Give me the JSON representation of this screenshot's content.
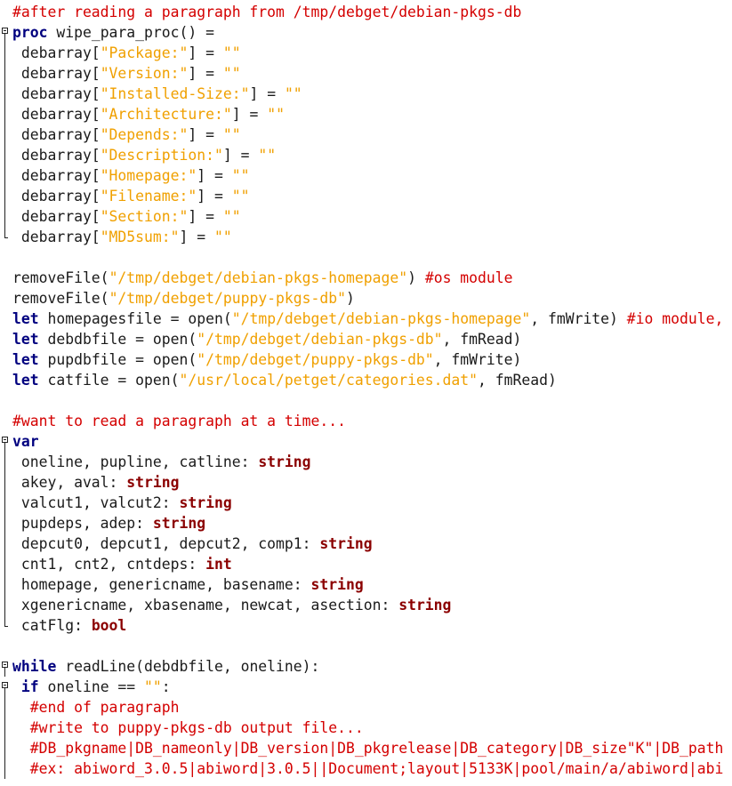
{
  "editor": {
    "lines": [
      {
        "fold": "none",
        "tokens": [
          {
            "t": "#after reading a paragraph from /tmp/debget/debian-pkgs-db",
            "c": "comment"
          }
        ]
      },
      {
        "fold": "start",
        "tokens": [
          {
            "t": "proc",
            "c": "keyword"
          },
          {
            "t": " wipe_para_proc() =",
            "c": "plain"
          }
        ]
      },
      {
        "fold": "body",
        "tokens": [
          {
            "t": " debarray[",
            "c": "plain"
          },
          {
            "t": "\"Package:\"",
            "c": "string"
          },
          {
            "t": "] = ",
            "c": "plain"
          },
          {
            "t": "\"\"",
            "c": "string"
          }
        ]
      },
      {
        "fold": "body",
        "tokens": [
          {
            "t": " debarray[",
            "c": "plain"
          },
          {
            "t": "\"Version:\"",
            "c": "string"
          },
          {
            "t": "] = ",
            "c": "plain"
          },
          {
            "t": "\"\"",
            "c": "string"
          }
        ]
      },
      {
        "fold": "body",
        "tokens": [
          {
            "t": " debarray[",
            "c": "plain"
          },
          {
            "t": "\"Installed-Size:\"",
            "c": "string"
          },
          {
            "t": "] = ",
            "c": "plain"
          },
          {
            "t": "\"\"",
            "c": "string"
          }
        ]
      },
      {
        "fold": "body",
        "tokens": [
          {
            "t": " debarray[",
            "c": "plain"
          },
          {
            "t": "\"Architecture:\"",
            "c": "string"
          },
          {
            "t": "] = ",
            "c": "plain"
          },
          {
            "t": "\"\"",
            "c": "string"
          }
        ]
      },
      {
        "fold": "body",
        "tokens": [
          {
            "t": " debarray[",
            "c": "plain"
          },
          {
            "t": "\"Depends:\"",
            "c": "string"
          },
          {
            "t": "] = ",
            "c": "plain"
          },
          {
            "t": "\"\"",
            "c": "string"
          }
        ]
      },
      {
        "fold": "body",
        "tokens": [
          {
            "t": " debarray[",
            "c": "plain"
          },
          {
            "t": "\"Description:\"",
            "c": "string"
          },
          {
            "t": "] = ",
            "c": "plain"
          },
          {
            "t": "\"\"",
            "c": "string"
          }
        ]
      },
      {
        "fold": "body",
        "tokens": [
          {
            "t": " debarray[",
            "c": "plain"
          },
          {
            "t": "\"Homepage:\"",
            "c": "string"
          },
          {
            "t": "] = ",
            "c": "plain"
          },
          {
            "t": "\"\"",
            "c": "string"
          }
        ]
      },
      {
        "fold": "body",
        "tokens": [
          {
            "t": " debarray[",
            "c": "plain"
          },
          {
            "t": "\"Filename:\"",
            "c": "string"
          },
          {
            "t": "] = ",
            "c": "plain"
          },
          {
            "t": "\"\"",
            "c": "string"
          }
        ]
      },
      {
        "fold": "body",
        "tokens": [
          {
            "t": " debarray[",
            "c": "plain"
          },
          {
            "t": "\"Section:\"",
            "c": "string"
          },
          {
            "t": "] = ",
            "c": "plain"
          },
          {
            "t": "\"\"",
            "c": "string"
          }
        ]
      },
      {
        "fold": "end",
        "tokens": [
          {
            "t": " debarray[",
            "c": "plain"
          },
          {
            "t": "\"MD5sum:\"",
            "c": "string"
          },
          {
            "t": "] = ",
            "c": "plain"
          },
          {
            "t": "\"\"",
            "c": "string"
          }
        ]
      },
      {
        "fold": "none",
        "tokens": []
      },
      {
        "fold": "none",
        "tokens": [
          {
            "t": "removeFile(",
            "c": "plain"
          },
          {
            "t": "\"/tmp/debget/debian-pkgs-homepage\"",
            "c": "string"
          },
          {
            "t": ") ",
            "c": "plain"
          },
          {
            "t": "#os module",
            "c": "comment"
          }
        ]
      },
      {
        "fold": "none",
        "tokens": [
          {
            "t": "removeFile(",
            "c": "plain"
          },
          {
            "t": "\"/tmp/debget/puppy-pkgs-db\"",
            "c": "string"
          },
          {
            "t": ")",
            "c": "plain"
          }
        ]
      },
      {
        "fold": "none",
        "tokens": [
          {
            "t": "let",
            "c": "keyword"
          },
          {
            "t": " homepagesfile = open(",
            "c": "plain"
          },
          {
            "t": "\"/tmp/debget/debian-pkgs-homepage\"",
            "c": "string"
          },
          {
            "t": ", fmWrite) ",
            "c": "plain"
          },
          {
            "t": "#io module, a",
            "c": "comment"
          }
        ]
      },
      {
        "fold": "none",
        "tokens": [
          {
            "t": "let",
            "c": "keyword"
          },
          {
            "t": " debdbfile = open(",
            "c": "plain"
          },
          {
            "t": "\"/tmp/debget/debian-pkgs-db\"",
            "c": "string"
          },
          {
            "t": ", fmRead)",
            "c": "plain"
          }
        ]
      },
      {
        "fold": "none",
        "tokens": [
          {
            "t": "let",
            "c": "keyword"
          },
          {
            "t": " pupdbfile = open(",
            "c": "plain"
          },
          {
            "t": "\"/tmp/debget/puppy-pkgs-db\"",
            "c": "string"
          },
          {
            "t": ", fmWrite)",
            "c": "plain"
          }
        ]
      },
      {
        "fold": "none",
        "tokens": [
          {
            "t": "let",
            "c": "keyword"
          },
          {
            "t": " catfile = open(",
            "c": "plain"
          },
          {
            "t": "\"/usr/local/petget/categories.dat\"",
            "c": "string"
          },
          {
            "t": ", fmRead)",
            "c": "plain"
          }
        ]
      },
      {
        "fold": "none",
        "tokens": []
      },
      {
        "fold": "none",
        "tokens": [
          {
            "t": "#want to read a paragraph at a time...",
            "c": "comment"
          }
        ]
      },
      {
        "fold": "start",
        "tokens": [
          {
            "t": "var",
            "c": "keyword"
          }
        ]
      },
      {
        "fold": "body",
        "tokens": [
          {
            "t": " oneline, pupline, catline: ",
            "c": "plain"
          },
          {
            "t": "string",
            "c": "type"
          }
        ]
      },
      {
        "fold": "body",
        "tokens": [
          {
            "t": " akey, aval: ",
            "c": "plain"
          },
          {
            "t": "string",
            "c": "type"
          }
        ]
      },
      {
        "fold": "body",
        "tokens": [
          {
            "t": " valcut1, valcut2: ",
            "c": "plain"
          },
          {
            "t": "string",
            "c": "type"
          }
        ]
      },
      {
        "fold": "body",
        "tokens": [
          {
            "t": " pupdeps, adep: ",
            "c": "plain"
          },
          {
            "t": "string",
            "c": "type"
          }
        ]
      },
      {
        "fold": "body",
        "tokens": [
          {
            "t": " depcut0, depcut1, depcut2, comp1: ",
            "c": "plain"
          },
          {
            "t": "string",
            "c": "type"
          }
        ]
      },
      {
        "fold": "body",
        "tokens": [
          {
            "t": " cnt1, cnt2, cntdeps: ",
            "c": "plain"
          },
          {
            "t": "int",
            "c": "type"
          }
        ]
      },
      {
        "fold": "body",
        "tokens": [
          {
            "t": " homepage, genericname, basename: ",
            "c": "plain"
          },
          {
            "t": "string",
            "c": "type"
          }
        ]
      },
      {
        "fold": "body",
        "tokens": [
          {
            "t": " xgenericname, xbasename, newcat, asection: ",
            "c": "plain"
          },
          {
            "t": "string",
            "c": "type"
          }
        ]
      },
      {
        "fold": "end",
        "tokens": [
          {
            "t": " catFlg: ",
            "c": "plain"
          },
          {
            "t": "bool",
            "c": "type"
          }
        ]
      },
      {
        "fold": "none",
        "tokens": []
      },
      {
        "fold": "start",
        "tokens": [
          {
            "t": "while",
            "c": "keyword"
          },
          {
            "t": " readLine(debdbfile, oneline):",
            "c": "plain"
          }
        ]
      },
      {
        "fold": "start",
        "tokens": [
          {
            "t": " ",
            "c": "plain"
          },
          {
            "t": "if",
            "c": "keyword"
          },
          {
            "t": " oneline == ",
            "c": "plain"
          },
          {
            "t": "\"\"",
            "c": "string"
          },
          {
            "t": ":",
            "c": "plain"
          }
        ]
      },
      {
        "fold": "body",
        "tokens": [
          {
            "t": "  #end of paragraph",
            "c": "comment"
          }
        ]
      },
      {
        "fold": "body",
        "tokens": [
          {
            "t": "  #write to puppy-pkgs-db output file...",
            "c": "comment"
          }
        ]
      },
      {
        "fold": "body",
        "tokens": [
          {
            "t": "  #DB_pkgname|DB_nameonly|DB_version|DB_pkgrelease|DB_category|DB_size\"K\"|DB_path",
            "c": "comment"
          }
        ]
      },
      {
        "fold": "body",
        "tokens": [
          {
            "t": "  #ex: abiword_3.0.5|abiword|3.0.5||Document;layout|5133K|pool/main/a/abiword|abi",
            "c": "comment"
          }
        ]
      }
    ]
  }
}
